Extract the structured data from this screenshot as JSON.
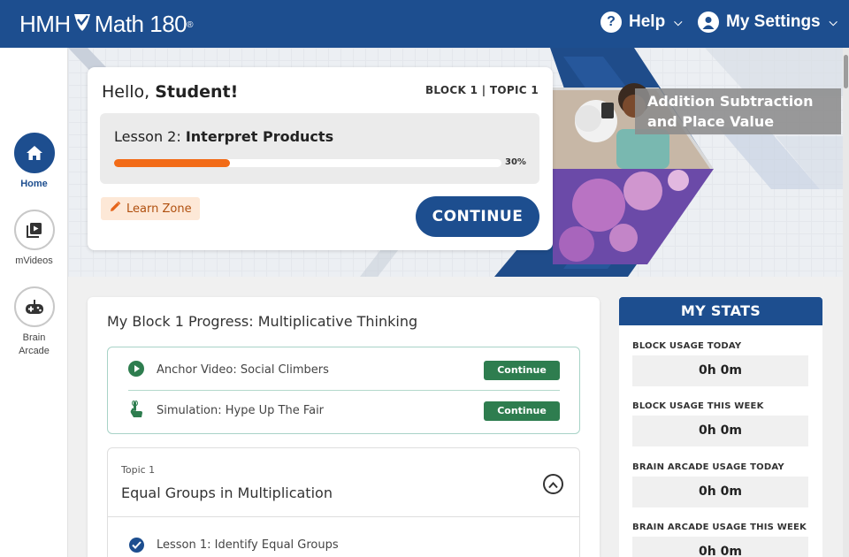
{
  "header": {
    "brand_left": "HMH",
    "brand_right": "Math 180",
    "brand_mark": "®",
    "help_label": "Help",
    "settings_label": "My Settings"
  },
  "sidebar": {
    "items": [
      {
        "label": "Home",
        "icon": "home-icon",
        "active": true
      },
      {
        "label": "mVideos",
        "icon": "video-library-icon",
        "active": false
      },
      {
        "label": "Brain Arcade",
        "icon": "gamepad-icon",
        "active": false
      }
    ]
  },
  "greeting": {
    "hello": "Hello,",
    "name": "Student!",
    "block_topic": "BLOCK 1 | TOPIC 1",
    "lesson_prefix": "Lesson 2:",
    "lesson_name": "Interpret Products",
    "progress_percent": 30,
    "progress_label": "30%",
    "learn_zone": "Learn Zone",
    "continue_label": "CONTINUE"
  },
  "hero": {
    "topic_title": "Addition Subtraction and Place Value"
  },
  "block_progress": {
    "title": "My Block 1 Progress: Multiplicative Thinking",
    "items": [
      {
        "label": "Anchor Video: Social Climbers",
        "icon": "play-circle-icon",
        "button": "Continue"
      },
      {
        "label": "Simulation: Hype Up The Fair",
        "icon": "hand-pointer-icon",
        "button": "Continue"
      }
    ],
    "topic": {
      "sub": "Topic 1",
      "name": "Equal Groups in Multiplication",
      "lessons": [
        "Lesson 1: Identify Equal Groups"
      ]
    }
  },
  "stats": {
    "title": "MY STATS",
    "items": [
      {
        "label": "BLOCK USAGE TODAY",
        "value": "0h 0m"
      },
      {
        "label": "BLOCK USAGE THIS WEEK",
        "value": "0h 0m"
      },
      {
        "label": "BRAIN ARCADE USAGE TODAY",
        "value": "0h 0m"
      },
      {
        "label": "BRAIN ARCADE USAGE THIS WEEK",
        "value": "0h 0m"
      }
    ]
  },
  "colors": {
    "primary": "#1d4e8f",
    "accent_orange": "#f26b17",
    "success_green": "#2e7d4f"
  }
}
